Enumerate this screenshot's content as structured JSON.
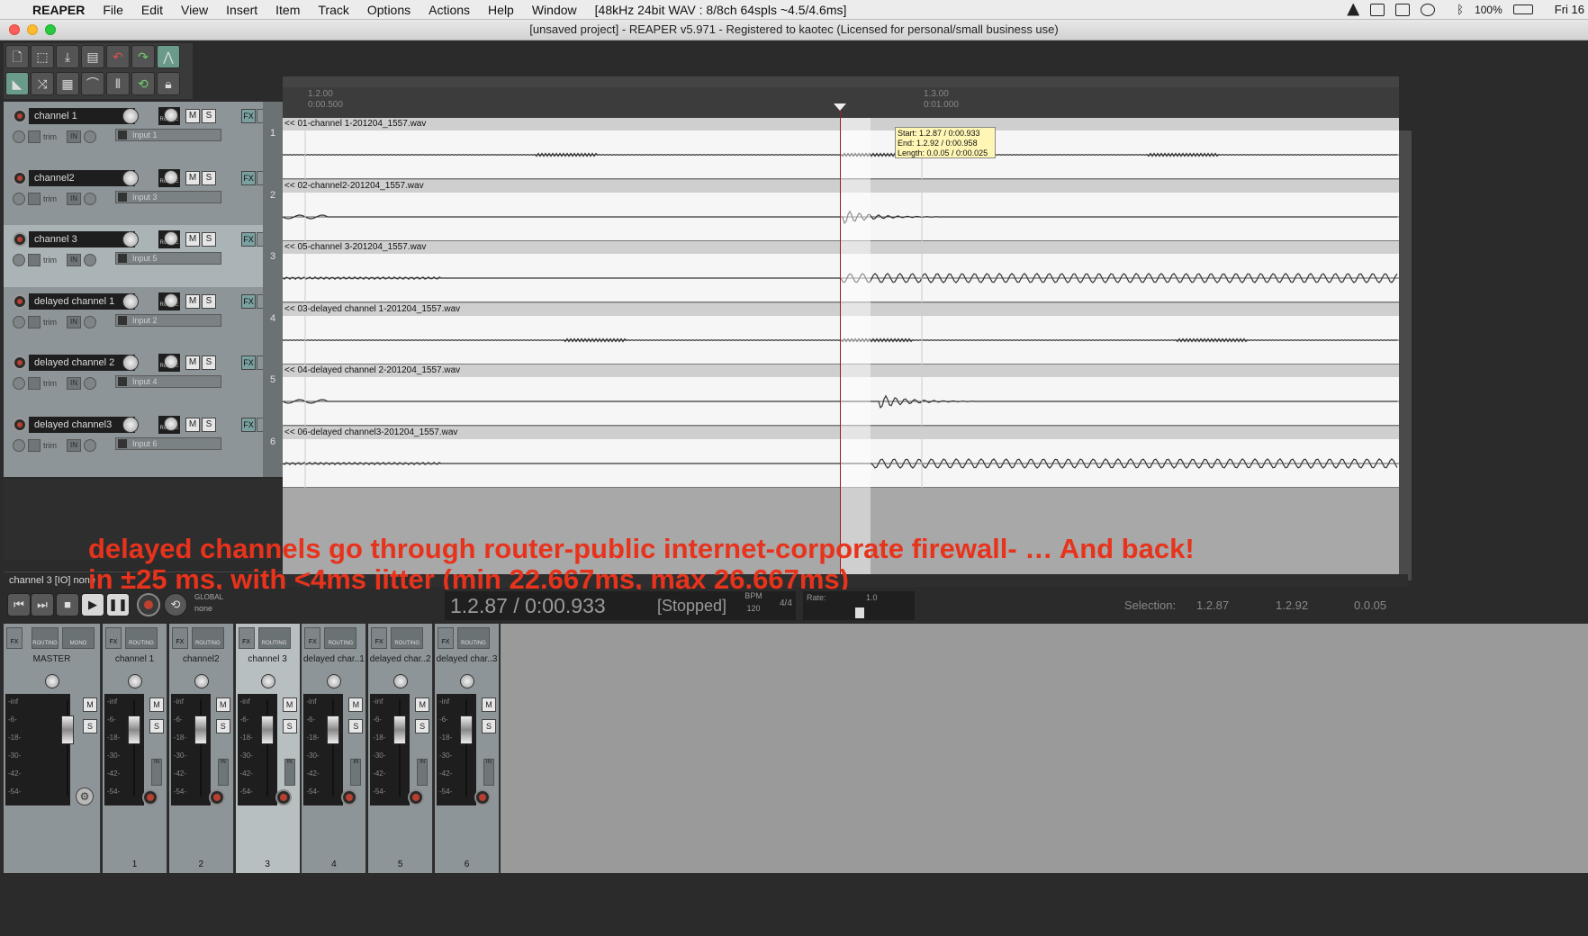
{
  "menubar": {
    "apple_icon": "apple-logo",
    "app_name": "REAPER",
    "items": [
      "File",
      "Edit",
      "View",
      "Insert",
      "Item",
      "Track",
      "Options",
      "Actions",
      "Help",
      "Window"
    ],
    "status": "[48kHz 24bit WAV : 8/8ch 64spls ~4.5/4.6ms]",
    "battery": "100%",
    "clock": "Fri 16"
  },
  "window": {
    "title": "[unsaved project] - REAPER v5.971 - Registered to kaotec (Licensed for personal/small business use)"
  },
  "ruler": {
    "marks": [
      {
        "bar": "1.2.00",
        "time": "0:00.500"
      },
      {
        "bar": "1.3.00",
        "time": "0:01.000"
      }
    ]
  },
  "tracks": [
    {
      "name": "channel 1",
      "input": "Input 1",
      "num": "1",
      "item": "<< 01-channel 1-201204_1557.wav"
    },
    {
      "name": "channel2",
      "input": "Input 3",
      "num": "2",
      "item": "<< 02-channel2-201204_1557.wav"
    },
    {
      "name": "channel 3",
      "input": "Input 5",
      "num": "3",
      "item": "<< 05-channel 3-201204_1557.wav"
    },
    {
      "name": "delayed channel 1",
      "input": "Input 2",
      "num": "4",
      "item": "<< 03-delayed channel 1-201204_1557.wav"
    },
    {
      "name": "delayed channel 2",
      "input": "Input 4",
      "num": "5",
      "item": "<< 04-delayed channel 2-201204_1557.wav"
    },
    {
      "name": "delayed channel3",
      "input": "Input 6",
      "num": "6",
      "item": "<< 06-delayed channel3-201204_1557.wav"
    }
  ],
  "track_controls": {
    "rec_label": "ROUTE",
    "m": "M",
    "s": "S",
    "fx": "FX",
    "trim": "trim",
    "in": "IN"
  },
  "tooltip": {
    "start": "Start: 1.2.87 / 0:00.933",
    "end": "End: 1.2.92 / 0:00.958",
    "length": "Length: 0.0.05 / 0:00.025"
  },
  "annotation": {
    "line1": "delayed channels go through router-public internet-corporate firewall- … And back!",
    "line2": "in ±25 ms, with <4ms jitter (min 22.667ms, max 26.667ms)"
  },
  "tcp_status": "channel 3 [IO] none",
  "transport": {
    "global": "GLOBAL",
    "none": "none",
    "position": "1.2.87 / 0:00.933",
    "state": "[Stopped]",
    "bpm_label": "BPM",
    "bpm": "120",
    "time_sig": "4/4",
    "rate_label": "Rate:",
    "rate": "1.0",
    "selection_label": "Selection:",
    "sel_start": "1.2.87",
    "sel_end": "1.2.92",
    "sel_len": "0.0.05"
  },
  "mixer": {
    "master": {
      "name": "MASTER",
      "mono": "MONO"
    },
    "strips": [
      {
        "name": "channel 1",
        "num": "1"
      },
      {
        "name": "channel2",
        "num": "2"
      },
      {
        "name": "channel 3",
        "num": "3"
      },
      {
        "name": "delayed char..1",
        "num": "4"
      },
      {
        "name": "delayed char..2",
        "num": "5"
      },
      {
        "name": "delayed char..3",
        "num": "6"
      }
    ],
    "routing": "ROUTING",
    "fx": "FX",
    "meter_labels": [
      "-inf",
      "-6-",
      "-18-",
      "-30-",
      "-42-",
      "-54-"
    ],
    "m": "M",
    "s": "S",
    "in": "IN"
  },
  "colors": {
    "accent_red": "#e8331c",
    "cursor": "#a01c1c"
  }
}
